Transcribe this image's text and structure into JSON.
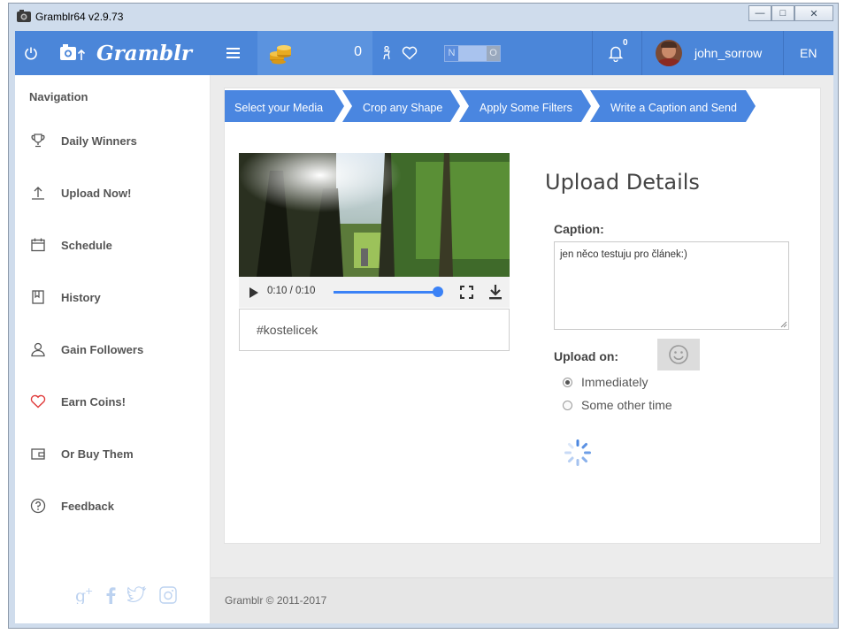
{
  "window": {
    "title": "Gramblr64 v2.9.73",
    "buttons": {
      "minimize": "—",
      "maximize": "□",
      "close": "✕"
    }
  },
  "header": {
    "brand": "Gramblr",
    "coins_count": "0",
    "toggle": {
      "left": "N",
      "right": "O"
    },
    "notifications_count": "0",
    "username": "john_sorrow",
    "language": "EN"
  },
  "sidebar": {
    "title": "Navigation",
    "items": [
      {
        "label": "Daily Winners",
        "icon": "trophy-icon"
      },
      {
        "label": "Upload Now!",
        "icon": "upload-arrow-icon"
      },
      {
        "label": "Schedule",
        "icon": "calendar-icon"
      },
      {
        "label": "History",
        "icon": "book-icon"
      },
      {
        "label": "Gain Followers",
        "icon": "user-icon"
      },
      {
        "label": "Earn Coins!",
        "icon": "heart-icon"
      },
      {
        "label": "Or Buy Them",
        "icon": "wallet-icon"
      },
      {
        "label": "Feedback",
        "icon": "question-icon"
      }
    ],
    "social": [
      "google-plus-icon",
      "facebook-icon",
      "twitter-icon",
      "instagram-icon"
    ]
  },
  "steps": [
    "Select your Media",
    "Crop any Shape",
    "Apply Some Filters",
    "Write a Caption and Send"
  ],
  "video": {
    "time": "0:10 / 0:10",
    "progress": 1.0
  },
  "tags": {
    "value": "#kostelicek"
  },
  "upload": {
    "title": "Upload Details",
    "caption_label": "Caption:",
    "caption_value": "jen něco testuju pro článek:)",
    "upload_on_label": "Upload on:",
    "options": [
      {
        "label": "Immediately",
        "checked": true
      },
      {
        "label": "Some other time",
        "checked": false
      }
    ]
  },
  "footer": {
    "text": "Gramblr © 2011-2017"
  },
  "colors": {
    "header_blue": "#4b86d9",
    "step_blue": "#4a86e0",
    "accent_heart": "#e03a3a"
  }
}
